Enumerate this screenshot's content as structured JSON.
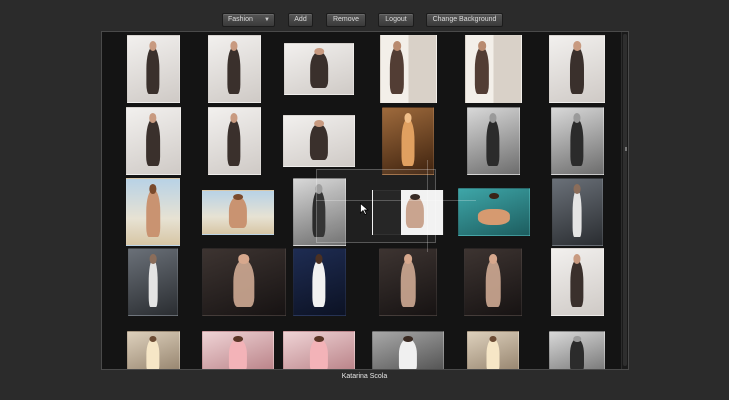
{
  "toolbar": {
    "category_select": "Fashion",
    "add_label": "Add",
    "remove_label": "Remove",
    "logout_label": "Logout",
    "change_background_label": "Change Background"
  },
  "gallery": {
    "rows": [
      [
        "t-light",
        "t-light",
        "t-light",
        "t-mag",
        "t-mag",
        "t-light"
      ],
      [
        "t-light",
        "t-light",
        "t-light",
        "t-warm",
        "t-bw",
        "t-bw"
      ],
      [
        "t-beach",
        "t-beach",
        "t-bw",
        "t-side",
        "t-teal",
        "t-city"
      ],
      [
        "t-city",
        "t-dark",
        "t-blue",
        "t-dark",
        "t-dark",
        "t-light"
      ],
      [
        "t-cream",
        "t-pink",
        "t-pink",
        "t-grey",
        "t-cream",
        "t-bw"
      ]
    ]
  },
  "caption": "Katarina Scola"
}
